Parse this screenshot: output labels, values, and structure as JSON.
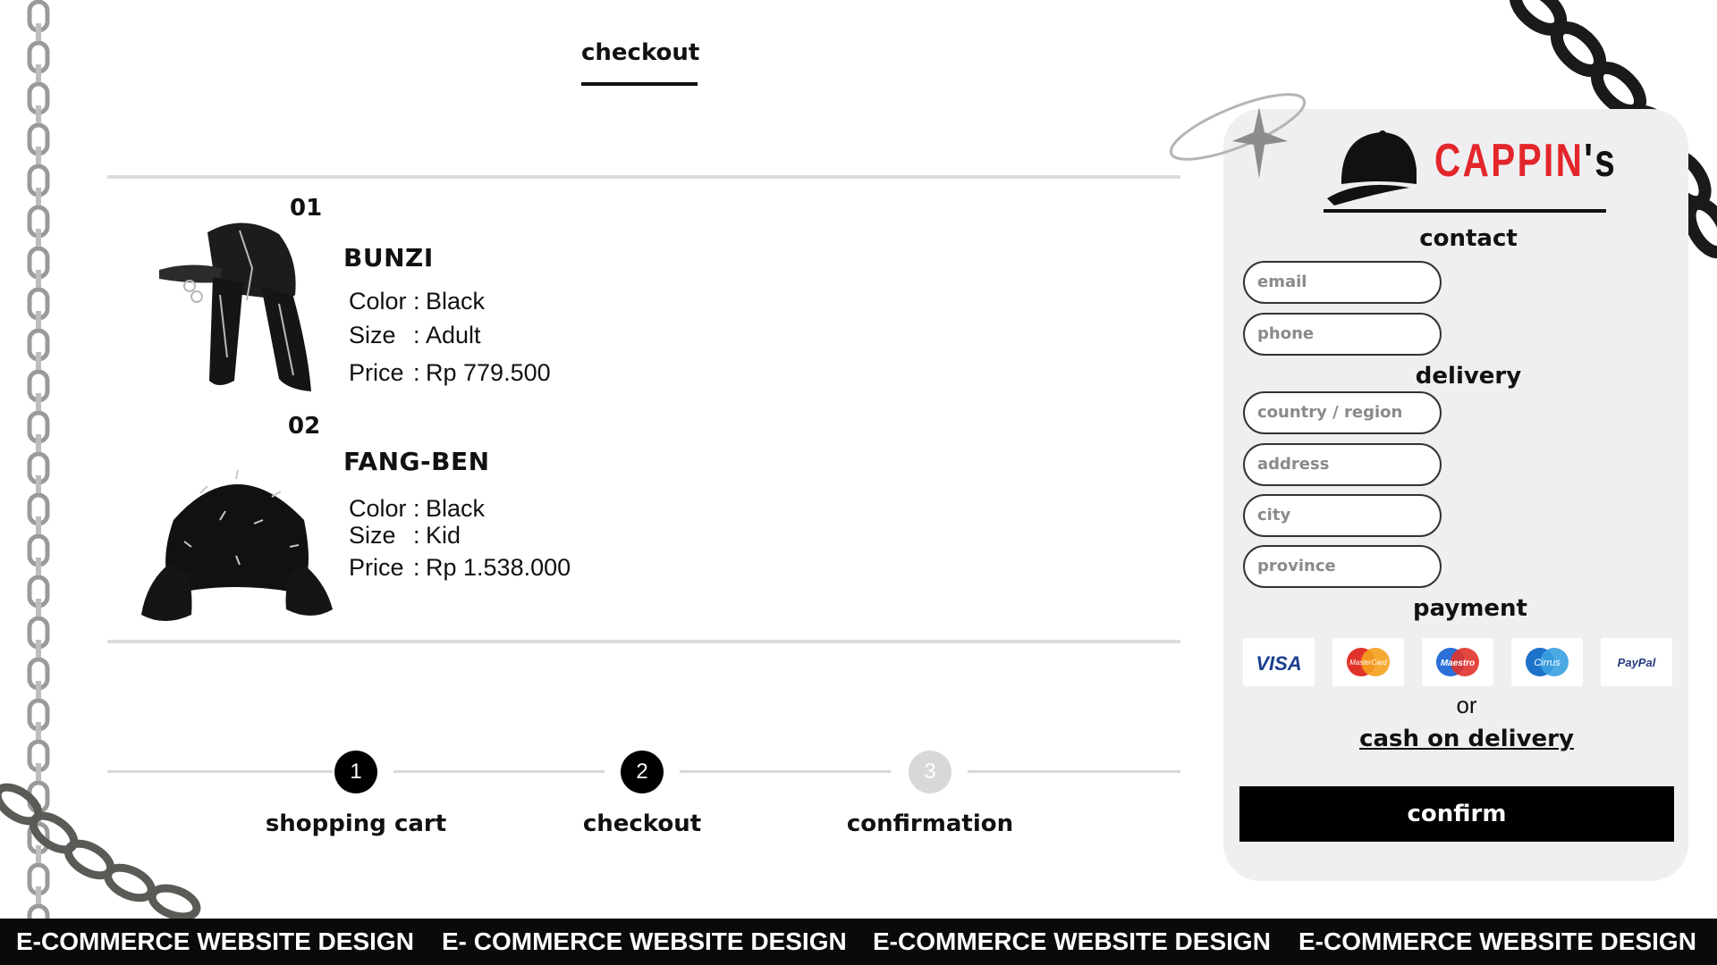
{
  "header": {
    "tab": "checkout"
  },
  "items": [
    {
      "num": "01",
      "name": "BUNZI",
      "color_label": "Color",
      "color": "Black",
      "size_label": "Size",
      "size": "Adult",
      "price_label": "Price",
      "price": "Rp 779.500",
      "icon": "spiked-cap-with-chains-icon"
    },
    {
      "num": "02",
      "name": "FANG-BEN",
      "color_label": "Color",
      "color": "Black",
      "size_label": "Size",
      "size": "Kid",
      "price_label": "Price",
      "price": "Rp  1.538.000",
      "icon": "fur-trapper-hat-icon"
    }
  ],
  "steps": [
    {
      "num": "1",
      "label": "shopping cart",
      "state": "done"
    },
    {
      "num": "2",
      "label": "checkout",
      "state": "active"
    },
    {
      "num": "3",
      "label": "confirmation",
      "state": "inactive"
    }
  ],
  "panel": {
    "logo": {
      "text": "CAPPIN",
      "apos": "'s"
    },
    "contact": {
      "heading": "contact",
      "email_placeholder": "email",
      "phone_placeholder": "phone"
    },
    "delivery": {
      "heading": "delivery",
      "country_placeholder": "country / region",
      "address_placeholder": "address",
      "city_placeholder": "city",
      "province_placeholder": "province"
    },
    "payment": {
      "heading": "payment",
      "methods": [
        "VISA",
        "MasterCard",
        "Maestro",
        "Cirrus",
        "PayPal"
      ],
      "or": "or",
      "cod": "cash on delivery"
    },
    "confirm_label": "confirm"
  },
  "banner": [
    "E-COMMERCE WEBSITE DESIGN",
    "E- COMMERCE WEBSITE DESIGN",
    "E-COMMERCE WEBSITE DESIGN",
    "E-COMMERCE WEBSITE DESIGN"
  ],
  "colors": {
    "accent": "#e3262b",
    "dark": "#0a0a0a",
    "panel": "#efeff1",
    "step_inactive": "#d8d8d8"
  }
}
